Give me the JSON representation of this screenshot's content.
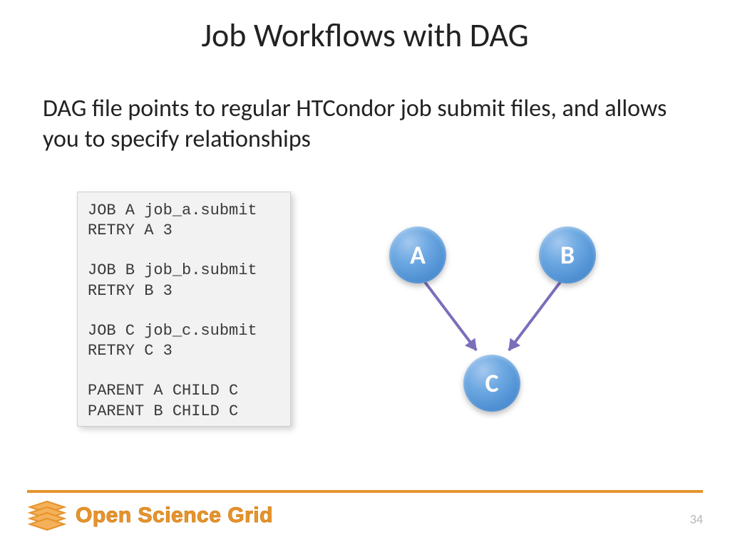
{
  "title": "Job Workflows with DAG",
  "subtitle": "DAG file points to regular HTCondor job submit files, and allows you to specify relationships",
  "code": "JOB A job_a.submit\nRETRY A 3\n\nJOB B job_b.submit\nRETRY B 3\n\nJOB C job_c.submit\nRETRY C 3\n\nPARENT A CHILD C\nPARENT B CHILD C",
  "diagram": {
    "nodes": {
      "a": "A",
      "b": "B",
      "c": "C"
    }
  },
  "footer": {
    "brand": "Open Science Grid"
  },
  "page_number": "34"
}
